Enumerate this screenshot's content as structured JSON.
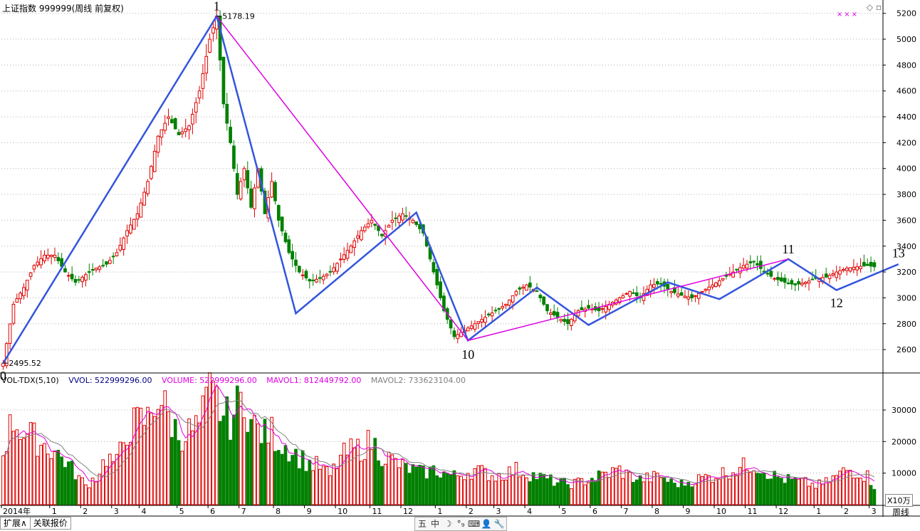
{
  "header": {
    "title": "上证指数 999999(周线 前复权)"
  },
  "corner_icons": {
    "restore": "◇",
    "maximize": "▫",
    "close": "×",
    "cross_marks": "×××"
  },
  "volume_header": {
    "indicator": "VOL-TDX(5,10)",
    "vvol": "VVOL: 522999296.00",
    "volume": "VOLUME: 522999296.00",
    "mavol1": "MAVOL1: 812449792.00",
    "mavol2": "MAVOL2: 733623104.00"
  },
  "colors": {
    "up": "#e00000",
    "down": "#008000",
    "wave_blue": "#3355dd",
    "wave_magenta": "#e000e0",
    "mavol1": "#e000e0",
    "mavol2": "#808080",
    "grid": "#b0b0b0",
    "axis": "#000000"
  },
  "chart_data": [
    {
      "type": "candlestick",
      "title": "上证指数 999999(周线 前复权)",
      "y_ticks": [
        2600,
        2800,
        3000,
        3200,
        3400,
        3600,
        3800,
        4000,
        4200,
        4400,
        4600,
        4800,
        5000,
        5200
      ],
      "ylim": [
        2430,
        5270
      ],
      "x_time_labels": [
        {
          "i": 0,
          "label": "2014年"
        },
        {
          "i": 14,
          "label": "1"
        },
        {
          "i": 23,
          "label": "2"
        },
        {
          "i": 32,
          "label": "3"
        },
        {
          "i": 40,
          "label": "4"
        },
        {
          "i": 51,
          "label": "5"
        },
        {
          "i": 60,
          "label": "6"
        },
        {
          "i": 69,
          "label": "7"
        },
        {
          "i": 79,
          "label": "8"
        },
        {
          "i": 88,
          "label": "9"
        },
        {
          "i": 97,
          "label": "10"
        },
        {
          "i": 107,
          "label": "11"
        },
        {
          "i": 116,
          "label": "12"
        },
        {
          "i": 126,
          "label": "1"
        },
        {
          "i": 135,
          "label": "2"
        },
        {
          "i": 143,
          "label": "3"
        },
        {
          "i": 152,
          "label": "4"
        },
        {
          "i": 162,
          "label": "5"
        },
        {
          "i": 171,
          "label": "6"
        },
        {
          "i": 180,
          "label": "7"
        },
        {
          "i": 189,
          "label": "8"
        },
        {
          "i": 198,
          "label": "9"
        },
        {
          "i": 207,
          "label": "10"
        },
        {
          "i": 216,
          "label": "11"
        },
        {
          "i": 225,
          "label": "12"
        },
        {
          "i": 236,
          "label": "1"
        },
        {
          "i": 244,
          "label": "2"
        },
        {
          "i": 252,
          "label": "3"
        }
      ],
      "ohlc_keypoints": [
        [
          0,
          2495
        ],
        [
          3,
          2950
        ],
        [
          6,
          3080
        ],
        [
          9,
          3250
        ],
        [
          12,
          3330
        ],
        [
          15,
          3330
        ],
        [
          18,
          3200
        ],
        [
          21,
          3120
        ],
        [
          24,
          3180
        ],
        [
          27,
          3230
        ],
        [
          30,
          3260
        ],
        [
          33,
          3350
        ],
        [
          36,
          3520
        ],
        [
          39,
          3650
        ],
        [
          42,
          3900
        ],
        [
          45,
          4250
        ],
        [
          48,
          4400
        ],
        [
          51,
          4260
        ],
        [
          54,
          4330
        ],
        [
          57,
          4600
        ],
        [
          60,
          5000
        ],
        [
          62,
          5178
        ],
        [
          64,
          4500
        ],
        [
          66,
          4200
        ],
        [
          68,
          3800
        ],
        [
          70,
          4000
        ],
        [
          72,
          3700
        ],
        [
          74,
          4000
        ],
        [
          76,
          3650
        ],
        [
          78,
          3900
        ],
        [
          80,
          3600
        ],
        [
          83,
          3350
        ],
        [
          86,
          3200
        ],
        [
          89,
          3130
        ],
        [
          92,
          3150
        ],
        [
          95,
          3200
        ],
        [
          98,
          3300
        ],
        [
          101,
          3400
        ],
        [
          104,
          3520
        ],
        [
          107,
          3600
        ],
        [
          110,
          3480
        ],
        [
          113,
          3600
        ],
        [
          116,
          3650
        ],
        [
          119,
          3600
        ],
        [
          122,
          3500
        ],
        [
          125,
          3200
        ],
        [
          128,
          2900
        ],
        [
          131,
          2700
        ],
        [
          134,
          2750
        ],
        [
          137,
          2800
        ],
        [
          140,
          2850
        ],
        [
          143,
          2900
        ],
        [
          146,
          2950
        ],
        [
          149,
          3050
        ],
        [
          152,
          3100
        ],
        [
          155,
          3050
        ],
        [
          158,
          2900
        ],
        [
          161,
          2850
        ],
        [
          164,
          2800
        ],
        [
          167,
          2900
        ],
        [
          170,
          2920
        ],
        [
          173,
          2900
        ],
        [
          176,
          2950
        ],
        [
          179,
          3000
        ],
        [
          182,
          3050
        ],
        [
          185,
          3000
        ],
        [
          188,
          3100
        ],
        [
          191,
          3110
        ],
        [
          194,
          3050
        ],
        [
          197,
          3020
        ],
        [
          200,
          3000
        ],
        [
          203,
          3050
        ],
        [
          206,
          3100
        ],
        [
          209,
          3150
        ],
        [
          212,
          3200
        ],
        [
          215,
          3250
        ],
        [
          218,
          3280
        ],
        [
          221,
          3200
        ],
        [
          224,
          3150
        ],
        [
          227,
          3120
        ],
        [
          230,
          3100
        ],
        [
          233,
          3120
        ],
        [
          236,
          3150
        ],
        [
          239,
          3160
        ],
        [
          242,
          3200
        ],
        [
          245,
          3230
        ],
        [
          248,
          3240
        ],
        [
          251,
          3250
        ],
        [
          253,
          3240
        ]
      ],
      "labels": [
        {
          "text": "2495.52",
          "i": 0,
          "y": 2495
        },
        {
          "text": "5178.19",
          "i": 62,
          "y": 5178
        }
      ],
      "wave_points": [
        {
          "label": "0",
          "i": 0,
          "y": 2495
        },
        {
          "label": "1",
          "i": 62,
          "y": 5178
        },
        {
          "label": "10",
          "i": 135,
          "y": 2660
        },
        {
          "label": "11",
          "i": 228,
          "y": 3300
        },
        {
          "label": "12",
          "i": 242,
          "y": 3060
        },
        {
          "label": "13",
          "i": 260,
          "y": 3270
        }
      ],
      "blue_path": [
        [
          0,
          2495
        ],
        [
          62,
          5178
        ],
        [
          85,
          2880
        ],
        [
          120,
          3660
        ],
        [
          135,
          2670
        ],
        [
          155,
          3080
        ],
        [
          170,
          2790
        ],
        [
          193,
          3120
        ],
        [
          208,
          2990
        ],
        [
          228,
          3300
        ],
        [
          242,
          3060
        ],
        [
          260,
          3260
        ]
      ],
      "magenta_path": [
        [
          62,
          5178
        ],
        [
          135,
          2670
        ],
        [
          228,
          3300
        ]
      ]
    },
    {
      "type": "bar",
      "title": "VOL-TDX(5,10)",
      "y_ticks": [
        10000,
        20000,
        30000
      ],
      "ylim": [
        0,
        37000
      ],
      "unit": "X10万",
      "period": "周线",
      "volume_keypoints": [
        [
          0,
          18000
        ],
        [
          3,
          27000
        ],
        [
          6,
          23000
        ],
        [
          9,
          21000
        ],
        [
          12,
          19000
        ],
        [
          15,
          17000
        ],
        [
          18,
          14000
        ],
        [
          21,
          10000
        ],
        [
          24,
          6000
        ],
        [
          27,
          9000
        ],
        [
          30,
          15000
        ],
        [
          33,
          13000
        ],
        [
          36,
          24000
        ],
        [
          39,
          26000
        ],
        [
          42,
          27000
        ],
        [
          45,
          35000
        ],
        [
          48,
          28000
        ],
        [
          51,
          22000
        ],
        [
          54,
          23000
        ],
        [
          57,
          25000
        ],
        [
          60,
          35000
        ],
        [
          62,
          33000
        ],
        [
          64,
          28000
        ],
        [
          66,
          27000
        ],
        [
          68,
          31000
        ],
        [
          70,
          35000
        ],
        [
          72,
          26000
        ],
        [
          74,
          24000
        ],
        [
          76,
          22000
        ],
        [
          78,
          23000
        ],
        [
          80,
          20000
        ],
        [
          83,
          18000
        ],
        [
          86,
          15000
        ],
        [
          89,
          13000
        ],
        [
          92,
          12000
        ],
        [
          95,
          9000
        ],
        [
          98,
          15000
        ],
        [
          101,
          17000
        ],
        [
          104,
          18000
        ],
        [
          107,
          20000
        ],
        [
          110,
          16000
        ],
        [
          113,
          14000
        ],
        [
          116,
          12000
        ],
        [
          119,
          11000
        ],
        [
          122,
          10000
        ],
        [
          125,
          11000
        ],
        [
          128,
          10000
        ],
        [
          131,
          9000
        ],
        [
          134,
          10000
        ],
        [
          137,
          11000
        ],
        [
          140,
          10000
        ],
        [
          143,
          9000
        ],
        [
          146,
          10000
        ],
        [
          149,
          11000
        ],
        [
          152,
          10000
        ],
        [
          155,
          9000
        ],
        [
          158,
          8000
        ],
        [
          161,
          7000
        ],
        [
          164,
          6500
        ],
        [
          167,
          7000
        ],
        [
          170,
          8000
        ],
        [
          173,
          9000
        ],
        [
          176,
          10000
        ],
        [
          179,
          11000
        ],
        [
          182,
          9000
        ],
        [
          185,
          8000
        ],
        [
          188,
          8500
        ],
        [
          191,
          9000
        ],
        [
          194,
          7000
        ],
        [
          197,
          6500
        ],
        [
          200,
          7500
        ],
        [
          203,
          8500
        ],
        [
          206,
          9000
        ],
        [
          209,
          10000
        ],
        [
          212,
          11000
        ],
        [
          215,
          12000
        ],
        [
          218,
          13000
        ],
        [
          221,
          11000
        ],
        [
          224,
          9000
        ],
        [
          227,
          8000
        ],
        [
          230,
          7500
        ],
        [
          233,
          7000
        ],
        [
          236,
          6000
        ],
        [
          239,
          7000
        ],
        [
          242,
          9000
        ],
        [
          245,
          11000
        ],
        [
          248,
          10500
        ],
        [
          251,
          9000
        ],
        [
          253,
          6000
        ]
      ]
    }
  ],
  "tabs": [
    "扩展∧",
    "关联报价"
  ],
  "toolbar": [
    "五",
    "中",
    "☽",
    "°₉",
    "⌨",
    "👤",
    "🔧"
  ]
}
